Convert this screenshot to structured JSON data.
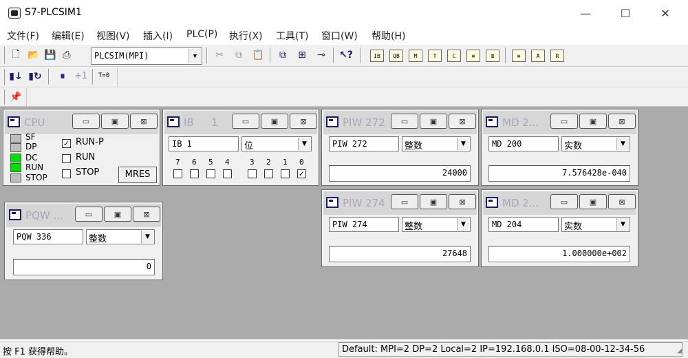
{
  "window": {
    "title": "S7-PLCSIM1",
    "minimize": "—",
    "maximize": "☐",
    "close": "✕"
  },
  "menu": [
    "文件(F)",
    "编辑(E)",
    "视图(V)",
    "插入(I)",
    "PLC(P)",
    "执行(X)",
    "工具(T)",
    "窗口(W)",
    "帮助(H)"
  ],
  "toolbar": {
    "connection": "PLCSIM(MPI)",
    "step_label": "+1",
    "timer_label": "T=0"
  },
  "cpu": {
    "title": "CPU",
    "leds": [
      {
        "label": "SF",
        "on": false
      },
      {
        "label": "DP",
        "on": false
      },
      {
        "label": "DC",
        "on": true
      },
      {
        "label": "RUN",
        "on": true
      },
      {
        "label": "STOP",
        "on": false
      }
    ],
    "modes": [
      {
        "label": "RUN-P",
        "checked": true
      },
      {
        "label": "RUN",
        "checked": false
      },
      {
        "label": "STOP",
        "checked": false
      }
    ],
    "mres": "MRES"
  },
  "ib": {
    "title": "IB",
    "title_num": "1",
    "address": "IB    1",
    "format": "位",
    "bits": [
      "7",
      "6",
      "5",
      "4",
      "3",
      "2",
      "1",
      "0"
    ],
    "bit_values": [
      false,
      false,
      false,
      false,
      false,
      false,
      false,
      true
    ]
  },
  "piw272": {
    "title": "PIW  272",
    "address": "PIW  272",
    "format": "整数",
    "value": "24000"
  },
  "piw274": {
    "title": "PIW  274",
    "address": "PIW  274",
    "format": "整数",
    "value": "27648"
  },
  "md200": {
    "title": "MD   2...",
    "address": "MD   200",
    "format": "实数",
    "value": "7.576428e-040"
  },
  "md204": {
    "title": "MD   2...",
    "address": "MD   204",
    "format": "实数",
    "value": "1.000000e+002"
  },
  "pqw": {
    "title": "PQW  ...",
    "address": "PQW  336",
    "format": "整数",
    "value": "0"
  },
  "status": {
    "help": "按 F1 获得帮助。",
    "connection": "Default:  MPI=2 DP=2 Local=2 IP=192.168.0.1 ISO=08-00-12-34-56"
  }
}
